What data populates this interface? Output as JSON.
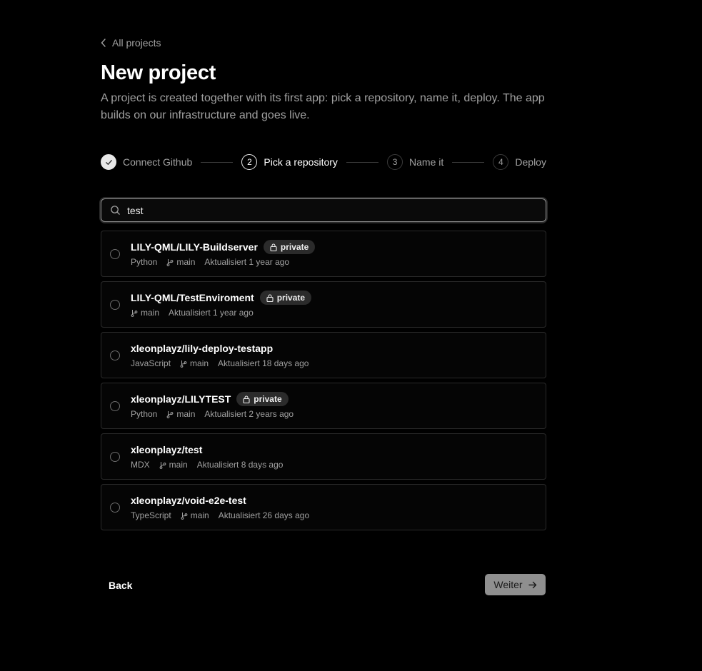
{
  "nav": {
    "back_link_label": "All projects"
  },
  "header": {
    "title": "New project",
    "description": "A project is created together with its first app: pick a repository, name it, deploy. The app builds on our infrastructure and goes live."
  },
  "stepper": {
    "steps": [
      {
        "number": "1",
        "label": "Connect Github",
        "state": "done"
      },
      {
        "number": "2",
        "label": "Pick a repository",
        "state": "active"
      },
      {
        "number": "3",
        "label": "Name it",
        "state": "pending"
      },
      {
        "number": "4",
        "label": "Deploy",
        "state": "pending"
      }
    ]
  },
  "search": {
    "value": "test",
    "icon": "search-icon"
  },
  "repositories": [
    {
      "name": "LILY-QML/LILY-Buildserver",
      "badge": "private",
      "language": "Python",
      "branch": "main",
      "updated": "Aktualisiert 1 year ago"
    },
    {
      "name": "LILY-QML/TestEnviroment",
      "badge": "private",
      "language": "",
      "branch": "main",
      "updated": "Aktualisiert 1 year ago"
    },
    {
      "name": "xleonplayz/lily-deploy-testapp",
      "badge": "",
      "language": "JavaScript",
      "branch": "main",
      "updated": "Aktualisiert 18 days ago"
    },
    {
      "name": "xleonplayz/LILYTEST",
      "badge": "private",
      "language": "Python",
      "branch": "main",
      "updated": "Aktualisiert 2 years ago"
    },
    {
      "name": "xleonplayz/test",
      "badge": "",
      "language": "MDX",
      "branch": "main",
      "updated": "Aktualisiert 8 days ago"
    },
    {
      "name": "xleonplayz/void-e2e-test",
      "badge": "",
      "language": "TypeScript",
      "branch": "main",
      "updated": "Aktualisiert 26 days ago"
    }
  ],
  "footer": {
    "back_label": "Back",
    "next_label": "Weiter"
  },
  "colors": {
    "background": "#000000",
    "text": "#ededed",
    "muted": "#a1a1a1",
    "border": "#2a2a2a",
    "disabled_button": "#8f8f8f"
  }
}
